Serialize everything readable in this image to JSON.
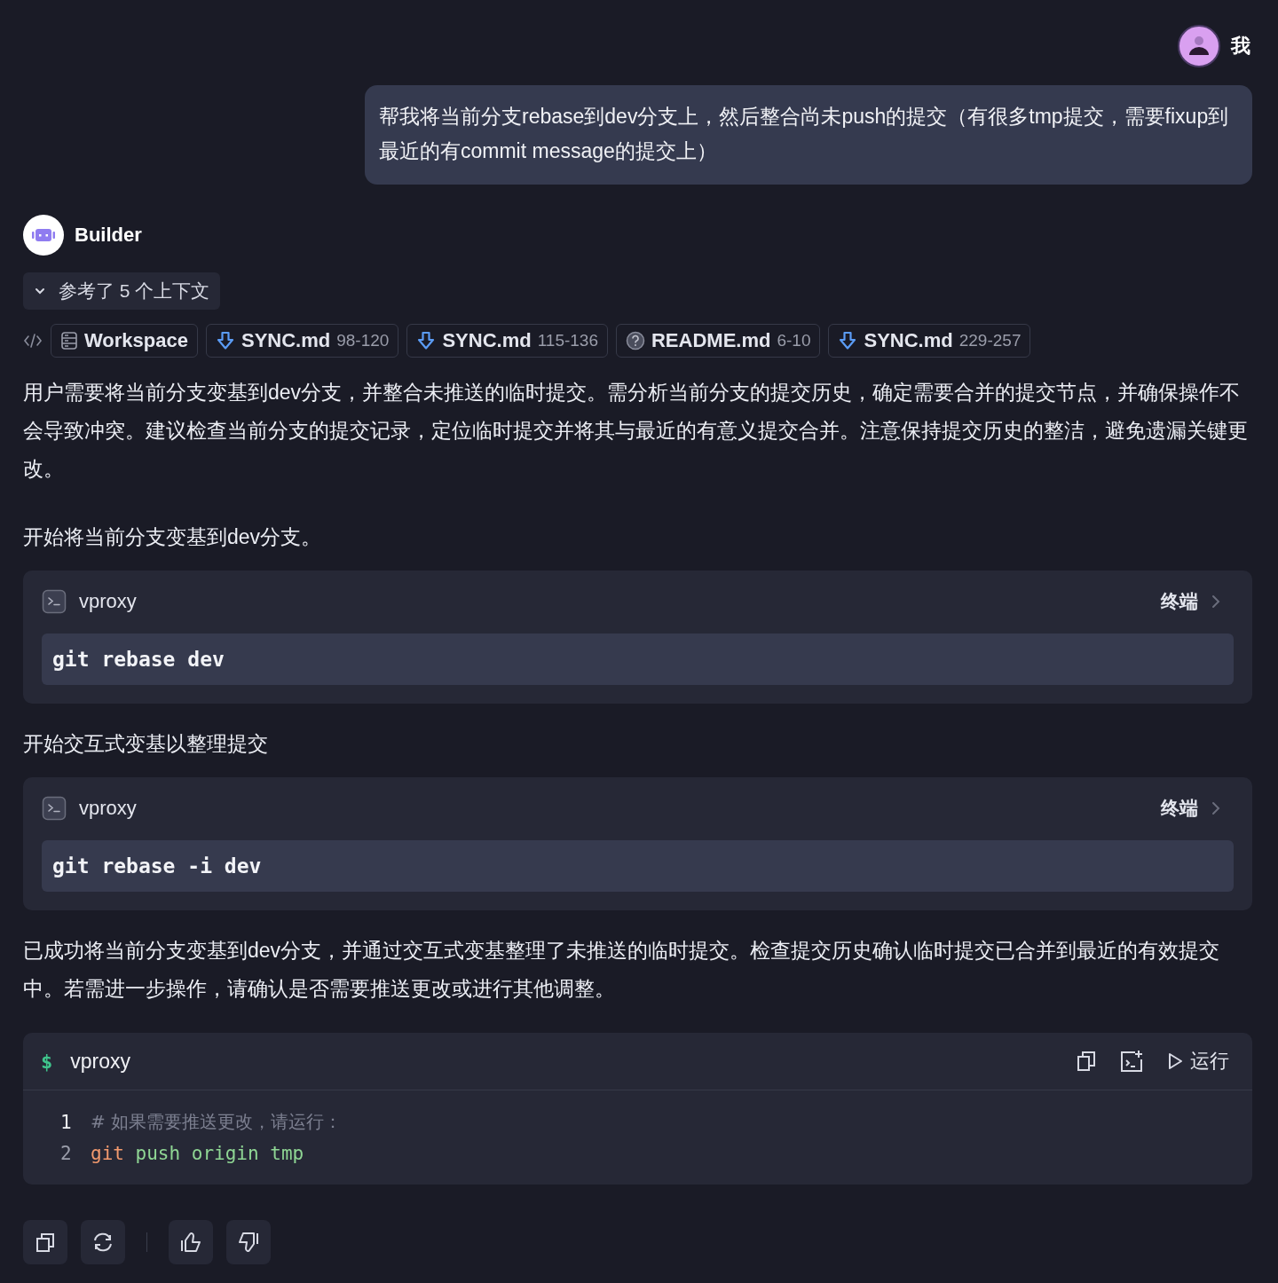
{
  "user": {
    "name": "我",
    "message": "帮我将当前分支rebase到dev分支上，然后整合尚未push的提交（有很多tmp提交，需要fixup到最近的有commit message的提交上）"
  },
  "assistant": {
    "name": "Builder",
    "context_toggle": {
      "label": "参考了 5 个上下文",
      "expanded": true
    },
    "context_chips": [
      {
        "kind": "workspace",
        "label": "Workspace"
      },
      {
        "kind": "download",
        "label": "SYNC.md",
        "range": "98-120"
      },
      {
        "kind": "download",
        "label": "SYNC.md",
        "range": "115-136"
      },
      {
        "kind": "help",
        "label": "README.md",
        "range": "6-10"
      },
      {
        "kind": "download",
        "label": "SYNC.md",
        "range": "229-257"
      }
    ],
    "blocks": [
      {
        "kind": "text",
        "text": "用户需要将当前分支变基到dev分支，并整合未推送的临时提交。需分析当前分支的提交历史，确定需要合并的提交节点，并确保操作不会导致冲突。建议检查当前分支的提交记录，定位临时提交并将其与最近的有意义提交合并。注意保持提交历史的整洁，避免遗漏关键更改。"
      },
      {
        "kind": "text",
        "text": "开始将当前分支变基到dev分支。"
      },
      {
        "kind": "terminal",
        "project": "vproxy",
        "action": "终端",
        "command": "git rebase dev"
      },
      {
        "kind": "text",
        "text": "开始交互式变基以整理提交"
      },
      {
        "kind": "terminal",
        "project": "vproxy",
        "action": "终端",
        "command": "git rebase -i dev"
      },
      {
        "kind": "text",
        "text": "已成功将当前分支变基到dev分支，并通过交互式变基整理了未推送的临时提交。检查提交历史确认临时提交已合并到最近的有效提交中。若需进一步操作，请确认是否需要推送更改或进行其他调整。"
      },
      {
        "kind": "code",
        "prompt": "$",
        "project": "vproxy",
        "run_label": "运行",
        "lines": [
          {
            "number": "1",
            "tokens": [
              {
                "kind": "comment",
                "text": "# 如果需要推送更改，请运行："
              }
            ]
          },
          {
            "number": "2",
            "tokens": [
              {
                "kind": "keyword",
                "text": "git"
              },
              {
                "kind": "string",
                "text": "push origin tmp"
              }
            ]
          }
        ]
      }
    ]
  }
}
